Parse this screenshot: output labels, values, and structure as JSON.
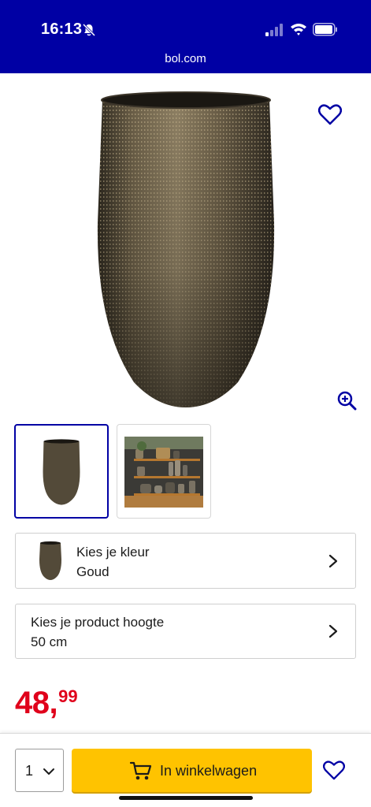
{
  "status_bar": {
    "time": "16:13",
    "icons": [
      "bell-slash-icon",
      "signal-icon",
      "wifi-icon",
      "battery-icon"
    ]
  },
  "browser": {
    "url": "bol.com"
  },
  "product": {
    "images": [
      "vase-gold-main",
      "vase-shelf-scene"
    ],
    "selected_image": 0,
    "icons": [
      "heart-icon",
      "zoom-in-icon"
    ]
  },
  "selectors": {
    "color": {
      "label": "Kies je kleur",
      "value": "Goud"
    },
    "height": {
      "label": "Kies je product hoogte",
      "value": "50 cm"
    }
  },
  "price": {
    "integer": "48,",
    "decimal": "99"
  },
  "bottom_bar": {
    "quantity": "1",
    "cart_label": "In winkelwagen"
  },
  "colors": {
    "brand_blue": "#0000a4",
    "price_red": "#e0001b",
    "cart_yellow": "#ffc300"
  }
}
